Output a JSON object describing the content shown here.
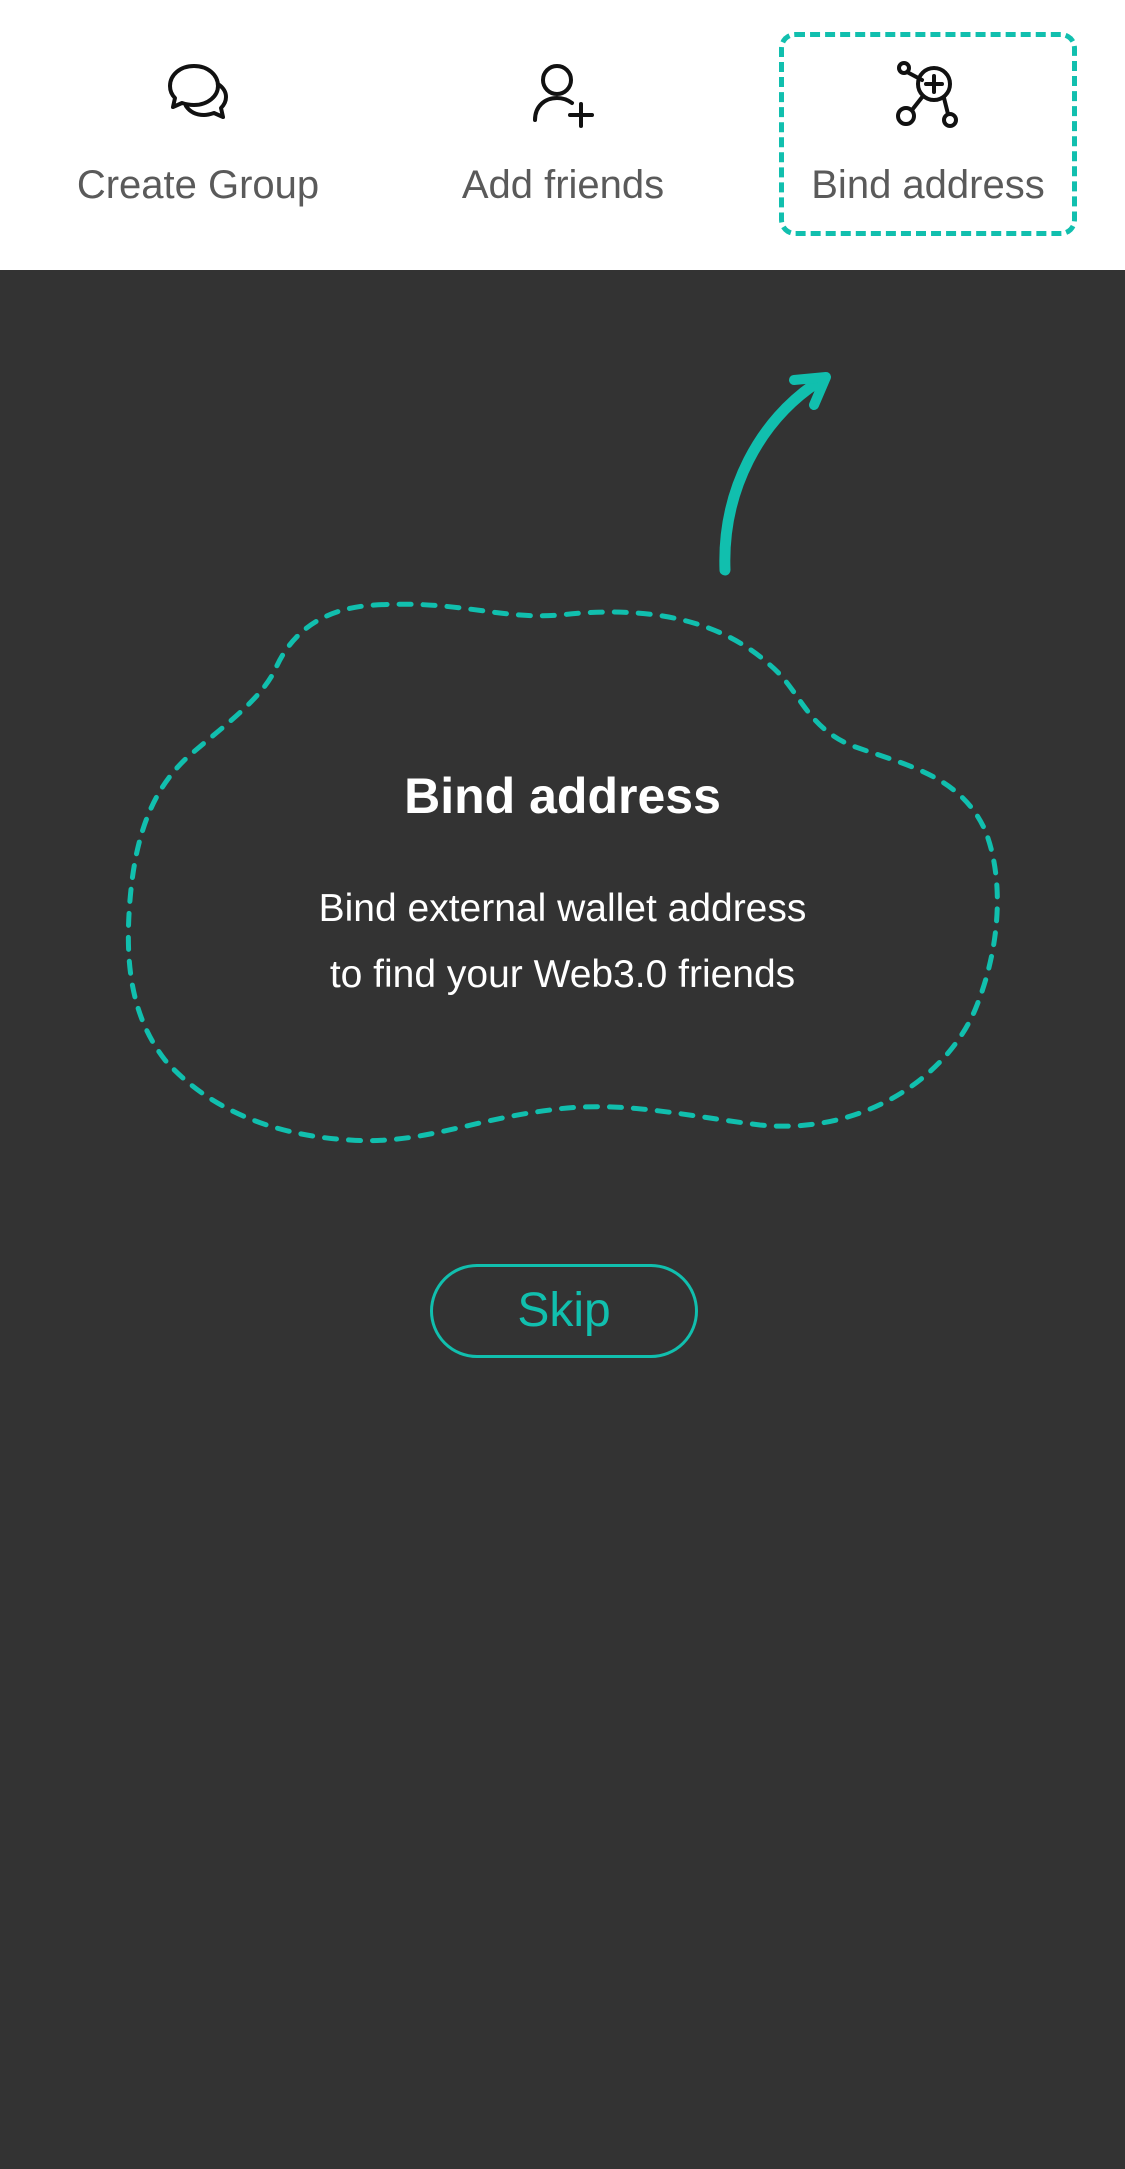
{
  "topbar": {
    "actions": [
      {
        "label": "Create Group",
        "icon": "chat-bubbles-icon"
      },
      {
        "label": "Add friends",
        "icon": "add-user-icon"
      },
      {
        "label": "Bind address",
        "icon": "bind-address-icon"
      }
    ]
  },
  "guide": {
    "title": "Bind address",
    "desc_line1": "Bind external wallet address",
    "desc_line2": "to find your Web3.0 friends",
    "skip_label": "Skip"
  },
  "colors": {
    "accent": "#11bfae",
    "overlay": "#333333",
    "topbar": "#ffffff",
    "label_text": "#5a5a5a"
  }
}
